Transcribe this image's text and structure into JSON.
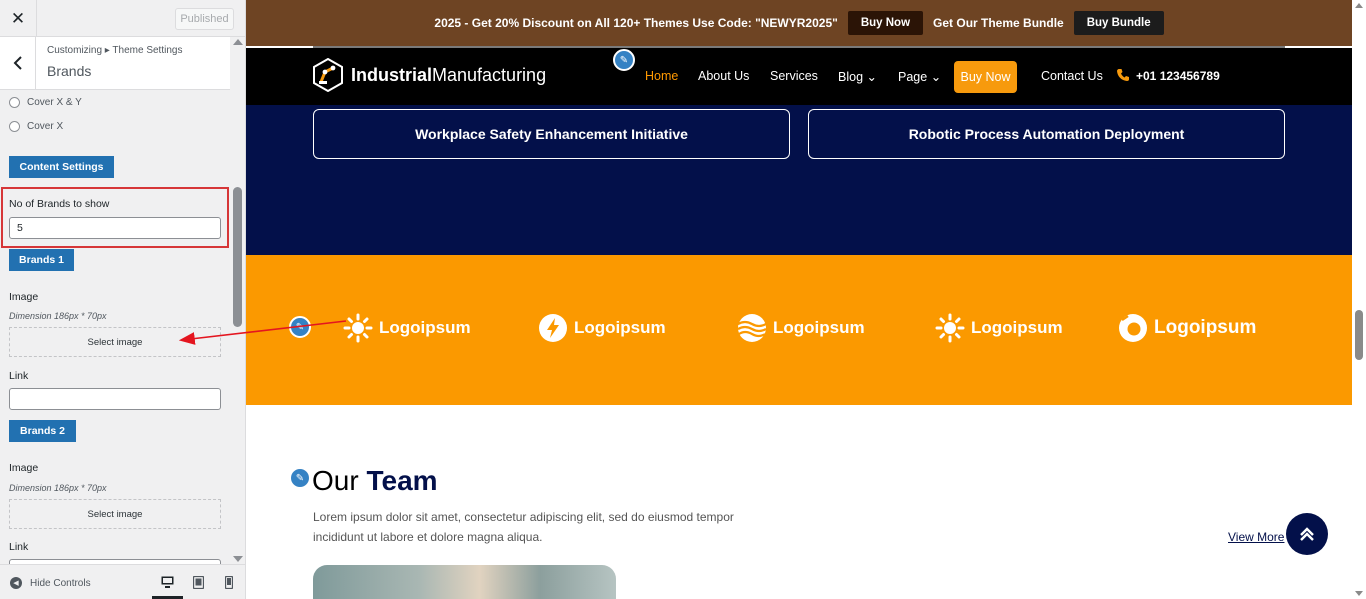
{
  "colors": {
    "accent": "#2271b1",
    "highlight_border": "#d63638",
    "topbar_bg": "#6e4423",
    "navy": "#03104a",
    "orange": "#fb9900",
    "annotation_arrow": "#e4151f"
  },
  "customizer": {
    "close_icon": "close-icon",
    "published_label": "Published",
    "breadcrumb": "Customizing ▸ Theme Settings",
    "title": "Brands",
    "radios": [
      {
        "label": "Cover X & Y"
      },
      {
        "label": "Cover X"
      }
    ],
    "content_settings_label": "Content Settings",
    "no_of_brands": {
      "label": "No of Brands to show",
      "value": "5"
    },
    "brand_1": {
      "heading": "Brands 1",
      "image_label": "Image",
      "dimension": "Dimension 186px * 70px",
      "select_label": "Select image",
      "link_label": "Link",
      "link_value": ""
    },
    "brand_2": {
      "heading": "Brands 2",
      "image_label": "Image",
      "dimension": "Dimension 186px * 70px",
      "select_label": "Select image",
      "link_label": "Link"
    },
    "footer": {
      "hide_controls_label": "Hide Controls",
      "devices": [
        "desktop-icon",
        "tablet-icon",
        "mobile-icon"
      ],
      "active_device": "desktop"
    }
  },
  "preview": {
    "topbar": {
      "text": "2025 - Get 20% Discount on All 120+ Themes Use Code: \"NEWYR2025\"",
      "buy_now": "Buy Now",
      "bundle_text": "Get Our Theme Bundle",
      "buy_bundle": "Buy Bundle"
    },
    "logo": {
      "bold": "Industrial",
      "regular": "Manufacturing"
    },
    "nav": {
      "items": [
        "Home",
        "About Us",
        "Services",
        "Blog",
        "Page"
      ],
      "active": "Home",
      "buy_now": "Buy Now",
      "contact": "Contact Us",
      "phone": "+01 123456789"
    },
    "pills": [
      "Workplace Safety Enhancement Initiative",
      "Robotic Process Automation Deployment"
    ],
    "brands": [
      {
        "name": "Logoipsum",
        "icon": "sun-icon"
      },
      {
        "name": "Logoipsum",
        "icon": "bolt-icon"
      },
      {
        "name": "Logoipsum",
        "icon": "waves-icon"
      },
      {
        "name": "Logoipsum",
        "icon": "sun-icon"
      },
      {
        "name": "Logoipsum",
        "icon": "ring-icon"
      }
    ],
    "team": {
      "title_light": "Our",
      "title_bold": "Team",
      "description": "Lorem ipsum dolor sit amet, consectetur adipiscing elit, sed do eiusmod tempor incididunt ut labore et dolore magna aliqua.",
      "view_more": "View More"
    }
  }
}
